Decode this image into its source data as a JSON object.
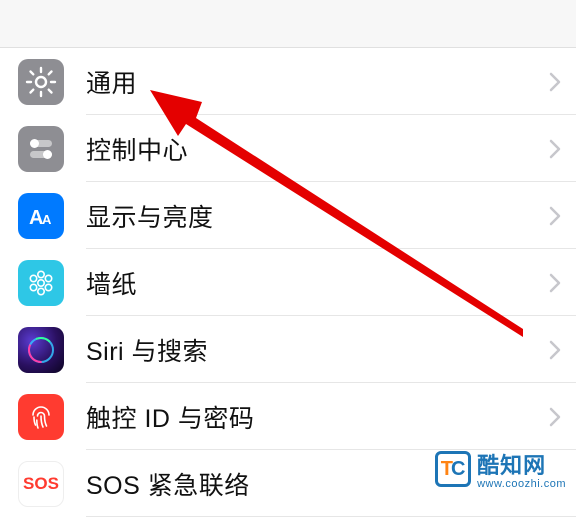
{
  "settings": {
    "items": [
      {
        "label": "通用",
        "icon": "gear-icon",
        "bg": "ic-gray"
      },
      {
        "label": "控制中心",
        "icon": "toggles-icon",
        "bg": "ic-gray"
      },
      {
        "label": "显示与亮度",
        "icon": "text-size-icon",
        "bg": "ic-blue"
      },
      {
        "label": "墙纸",
        "icon": "flower-icon",
        "bg": "ic-cyan"
      },
      {
        "label": "Siri 与搜索",
        "icon": "siri-icon",
        "bg": ""
      },
      {
        "label": "触控 ID 与密码",
        "icon": "fingerprint-icon",
        "bg": "ic-red"
      },
      {
        "label": "SOS 紧急联络",
        "icon": "sos-icon",
        "bg": "ic-red"
      }
    ]
  },
  "watermark": {
    "brand": "酷知网",
    "url": "www.coozhi.com"
  }
}
